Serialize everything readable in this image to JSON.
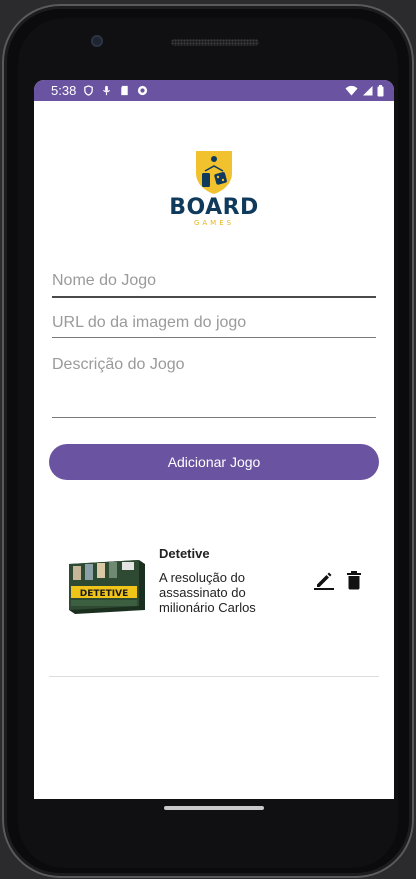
{
  "status_bar": {
    "time": "5:38",
    "left_icons": [
      "vpn-shield-icon",
      "mic-icon",
      "sd-card-icon",
      "game-controller-icon"
    ],
    "right_icons": [
      "wifi-icon",
      "signal-icon",
      "battery-icon"
    ]
  },
  "logo": {
    "brand": "BOARD",
    "sub": "GAMES",
    "colors": {
      "shield": "#f2c12e",
      "text": "#0f3a5c",
      "accent": "#e6b51f"
    }
  },
  "form": {
    "name_placeholder": "Nome do Jogo",
    "url_placeholder": "URL do da imagem do jogo",
    "description_placeholder": "Descrição do Jogo",
    "add_button": "Adicionar Jogo"
  },
  "games": [
    {
      "title": "Detetive",
      "description": "A resolução do assassinato do milionário Carlos",
      "cover_text": "DETETIVE",
      "actions": [
        "edit-icon",
        "delete-icon"
      ]
    }
  ],
  "colors": {
    "primary": "#6a53a0",
    "background": "#ffffff"
  }
}
